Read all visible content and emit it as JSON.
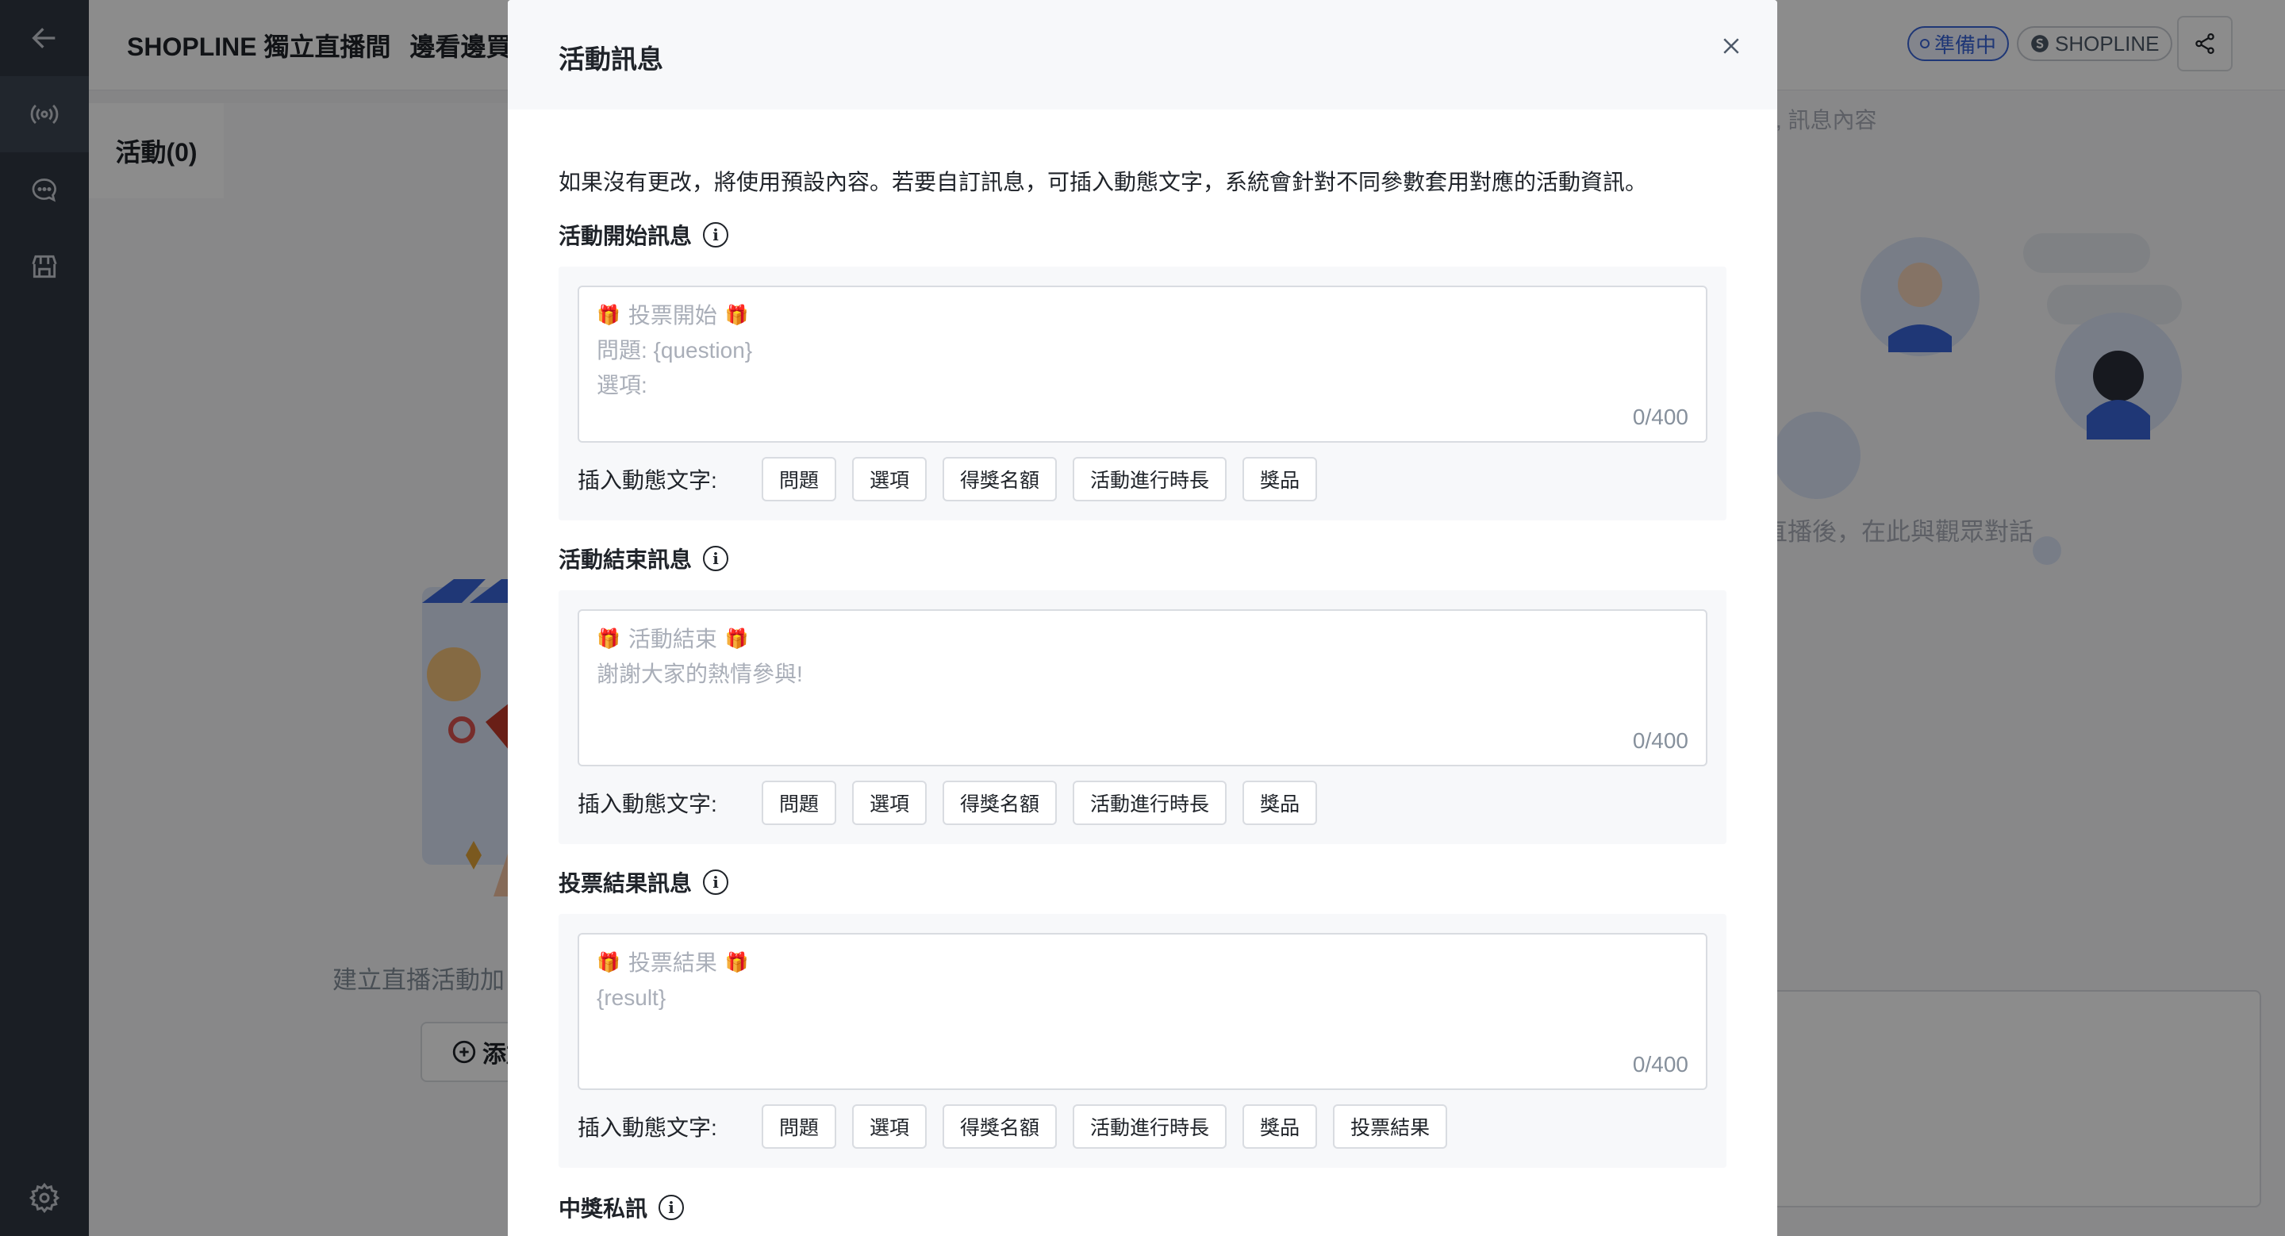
{
  "app": {
    "title": "SHOPLINE 獨立直播間",
    "subtitle": "邊看邊買",
    "status_badge": "準備中",
    "brand_badge": "SHOPLINE"
  },
  "sidebar": {
    "icons": [
      "back-arrow-icon",
      "live-broadcast-icon",
      "chat-icon",
      "store-icon",
      "settings-icon"
    ]
  },
  "activity_panel": {
    "tab_label": "活動(0)",
    "empty_text": "建立直播活動加",
    "add_button_label": "添加"
  },
  "chat_panel": {
    "search_placeholder": "稱, 訊息內容",
    "empty_text": "直播後，在此與觀眾對話"
  },
  "modal": {
    "title": "活動訊息",
    "intro": "如果沒有更改，將使用預設內容。若要自訂訊息，可插入動態文字，系統會針對不同參數套用對應的活動資訊。",
    "insert_label": "插入動態文字:",
    "sections": [
      {
        "title": "活動開始訊息",
        "lines": [
          "投票開始",
          "問題: {question}",
          "選項:"
        ],
        "counter": "0/400",
        "tags": [
          "問題",
          "選項",
          "得獎名額",
          "活動進行時長",
          "獎品"
        ]
      },
      {
        "title": "活動結束訊息",
        "lines": [
          "活動結束",
          "謝謝大家的熱情參與!"
        ],
        "counter": "0/400",
        "tags": [
          "問題",
          "選項",
          "得獎名額",
          "活動進行時長",
          "獎品"
        ]
      },
      {
        "title": "投票結果訊息",
        "lines": [
          "投票結果",
          "{result}"
        ],
        "counter": "0/400",
        "tags": [
          "問題",
          "選項",
          "得獎名額",
          "活動進行時長",
          "獎品",
          "投票結果"
        ]
      }
    ],
    "cutoff_section_title": "中獎私訊"
  },
  "colors": {
    "sidebar": "#303843",
    "accent": "#3a64d8",
    "overlay": "rgba(0,0,0,0.45)"
  }
}
